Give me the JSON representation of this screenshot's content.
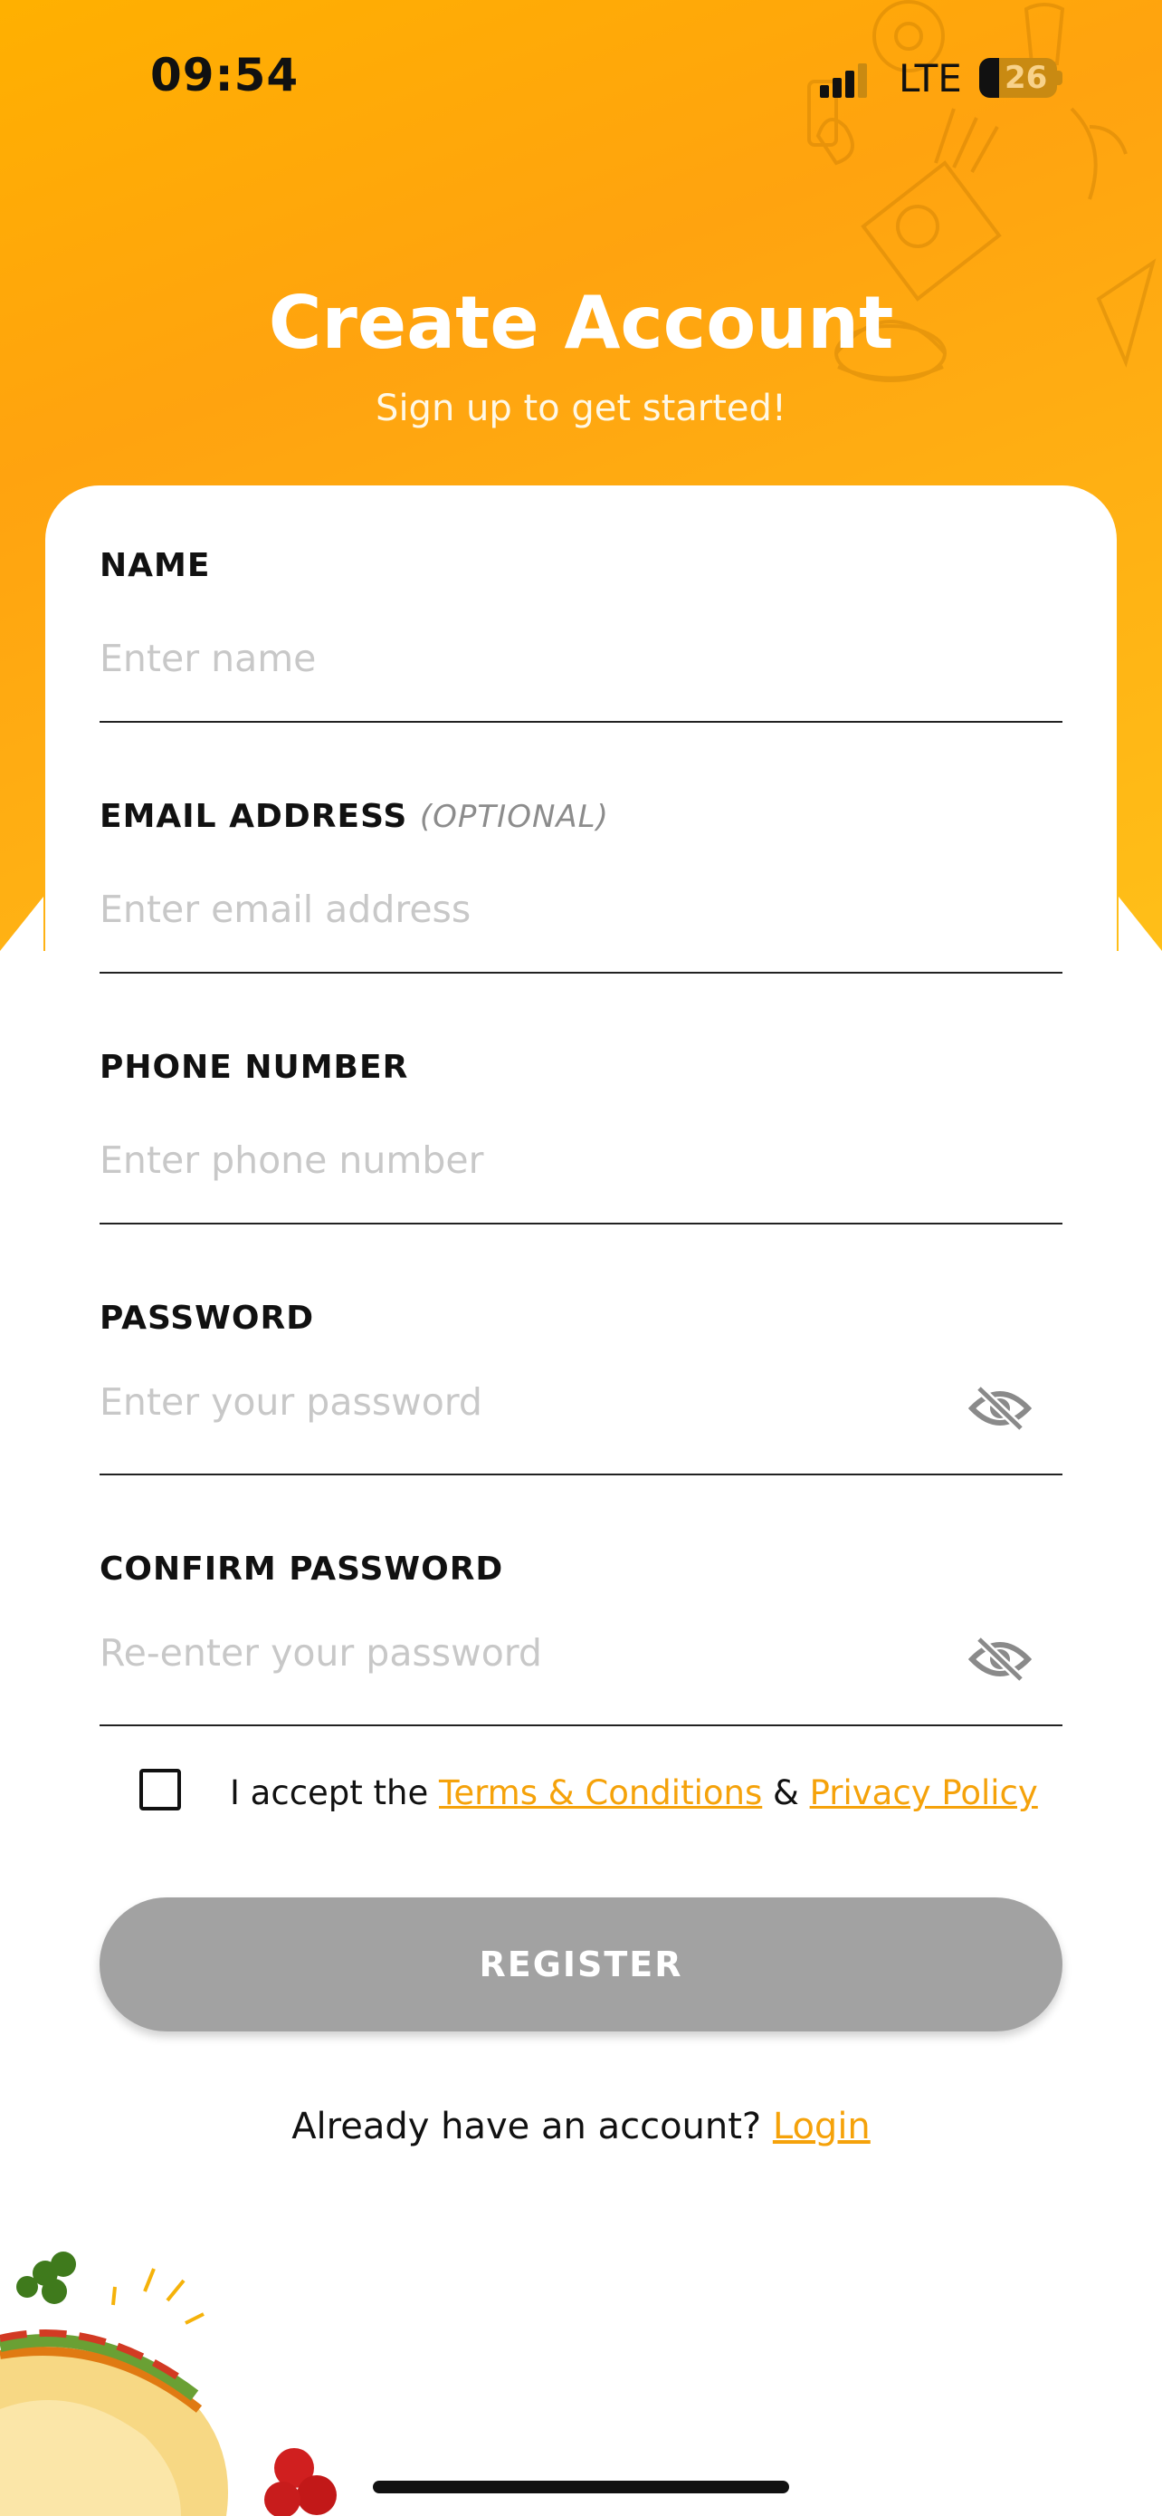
{
  "status_bar": {
    "time": "09:54",
    "network": "LTE",
    "battery": "26",
    "icons": [
      "signal-icon",
      "battery-icon"
    ]
  },
  "header": {
    "title": "Create Account",
    "subtitle": "Sign up to get started!"
  },
  "form": {
    "name": {
      "label": "NAME",
      "placeholder": "Enter name",
      "value": ""
    },
    "email": {
      "label": "EMAIL ADDRESS",
      "optional_label": "(OPTIONAL)",
      "placeholder": "Enter email address",
      "value": ""
    },
    "phone": {
      "label": "PHONE NUMBER",
      "placeholder": "Enter phone number",
      "value": ""
    },
    "password": {
      "label": "PASSWORD",
      "placeholder": "Enter your password",
      "value": "",
      "toggle_icon": "eye-off-icon"
    },
    "confirm_password": {
      "label": "CONFIRM PASSWORD",
      "placeholder": "Re-enter your password",
      "value": "",
      "toggle_icon": "eye-off-icon"
    }
  },
  "terms": {
    "checked": false,
    "prefix": "I accept the",
    "terms_link": "Terms & Conditions",
    "separator": "&",
    "privacy_link": "Privacy Policy"
  },
  "register_button": {
    "label": "REGISTER"
  },
  "footer": {
    "prompt": "Already have an account?",
    "login_link": "Login"
  },
  "colors": {
    "accent": "#f5a20a",
    "header_gradient_start": "#ffa30f",
    "header_gradient_end": "#ffbf18",
    "button_disabled": "#a2a2a2"
  }
}
